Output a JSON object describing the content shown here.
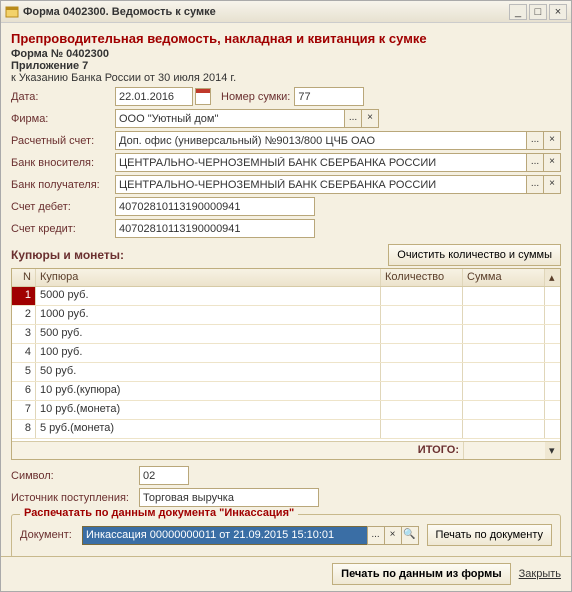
{
  "window": {
    "title": "Форма 0402300. Ведомость к сумке"
  },
  "header": {
    "heading": "Препроводительная ведомость, накладная и квитанция к сумке",
    "form_no": "Форма № 0402300",
    "appendix": "Приложение 7",
    "ref": "к Указанию Банка России от 30 июля 2014 г."
  },
  "form": {
    "date_label": "Дата:",
    "date_value": "22.01.2016",
    "bag_label": "Номер сумки:",
    "bag_value": "77",
    "firm_label": "Фирма:",
    "firm_value": "ООО \"Уютный дом\"",
    "acct_label": "Расчетный счет:",
    "acct_value": "Доп. офис (универсальный) №9013/800 ЦЧБ ОАО",
    "bank_in_label": "Банк вносителя:",
    "bank_in_value": "ЦЕНТРАЛЬНО-ЧЕРНОЗЕМНЫЙ БАНК СБЕРБАНКА РОССИИ",
    "bank_out_label": "Банк получателя:",
    "bank_out_value": "ЦЕНТРАЛЬНО-ЧЕРНОЗЕМНЫЙ БАНК СБЕРБАНКА РОССИИ",
    "debit_label": "Счет дебет:",
    "debit_value": "40702810113190000941",
    "credit_label": "Счет кредит:",
    "credit_value": "40702810113190000941"
  },
  "grid": {
    "title": "Купюры и монеты:",
    "clear_btn": "Очистить количество и суммы",
    "col_n": "N",
    "col_k": "Купюра",
    "col_q": "Количество",
    "col_s": "Сумма",
    "total_label": "ИТОГО:",
    "rows": [
      {
        "n": "1",
        "k": "5000 руб."
      },
      {
        "n": "2",
        "k": "1000 руб."
      },
      {
        "n": "3",
        "k": "500 руб."
      },
      {
        "n": "4",
        "k": "100 руб."
      },
      {
        "n": "5",
        "k": "50 руб."
      },
      {
        "n": "6",
        "k": "10 руб.(купюра)"
      },
      {
        "n": "7",
        "k": "10 руб.(монета)"
      },
      {
        "n": "8",
        "k": "5 руб.(монета)"
      }
    ]
  },
  "bottom": {
    "symbol_label": "Символ:",
    "symbol_value": "02",
    "source_label": "Источник поступления:",
    "source_value": "Торговая выручка"
  },
  "printbox": {
    "legend": "Распечатать по данным документа \"Инкассация\"",
    "doc_label": "Документ:",
    "doc_value": "Инкассация 00000000011 от 21.09.2015 15:10:01",
    "print_btn": "Печать по документу"
  },
  "footer": {
    "print_form": "Печать по данным из формы",
    "close": "Закрыть"
  }
}
